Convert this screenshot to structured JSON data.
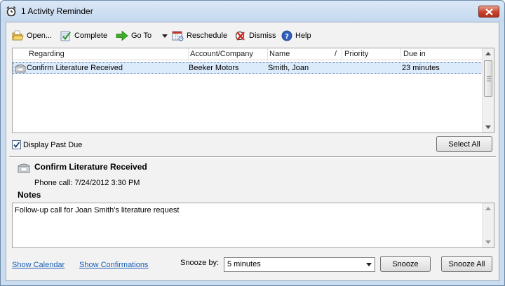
{
  "window": {
    "title": "1 Activity Reminder"
  },
  "toolbar": {
    "open_label": "Open...",
    "complete_label": "Complete",
    "goto_label": "Go To",
    "reschedule_label": "Reschedule",
    "dismiss_label": "Dismiss",
    "help_label": "Help"
  },
  "list": {
    "columns": [
      "Regarding",
      "Account/Company",
      "Name",
      "/",
      "Priority",
      "Due in"
    ],
    "rows": [
      {
        "regarding": "Confirm Literature Received",
        "account": "Beeker Motors",
        "name": "Smith, Joan",
        "priority": "",
        "due_in": "23 minutes"
      }
    ]
  },
  "options": {
    "display_past_due_label": "Display Past Due",
    "display_past_due_checked": true,
    "select_all_label": "Select All"
  },
  "detail": {
    "title": "Confirm Literature Received",
    "subtitle": "Phone call: 7/24/2012 3:30 PM",
    "notes_label": "Notes",
    "notes_text": "Follow-up call for Joan Smith's literature request"
  },
  "footer": {
    "show_calendar": "Show Calendar",
    "show_confirmations": "Show Confirmations",
    "snooze_by_label": "Snooze by:",
    "snooze_value": "5 minutes",
    "snooze_button": "Snooze",
    "snooze_all_button": "Snooze All"
  },
  "icons": {
    "title": "alarm-clock-icon",
    "open": "open-folder-icon",
    "complete": "complete-checklist-icon",
    "goto": "green-arrow-icon",
    "reschedule": "reschedule-calendar-icon",
    "dismiss": "dismiss-x-icon",
    "help": "help-question-icon",
    "phone": "phone-icon"
  },
  "colors": {
    "link": "#1a5fb4",
    "selection": "#dcebfb",
    "close_button": "#c7412a"
  }
}
